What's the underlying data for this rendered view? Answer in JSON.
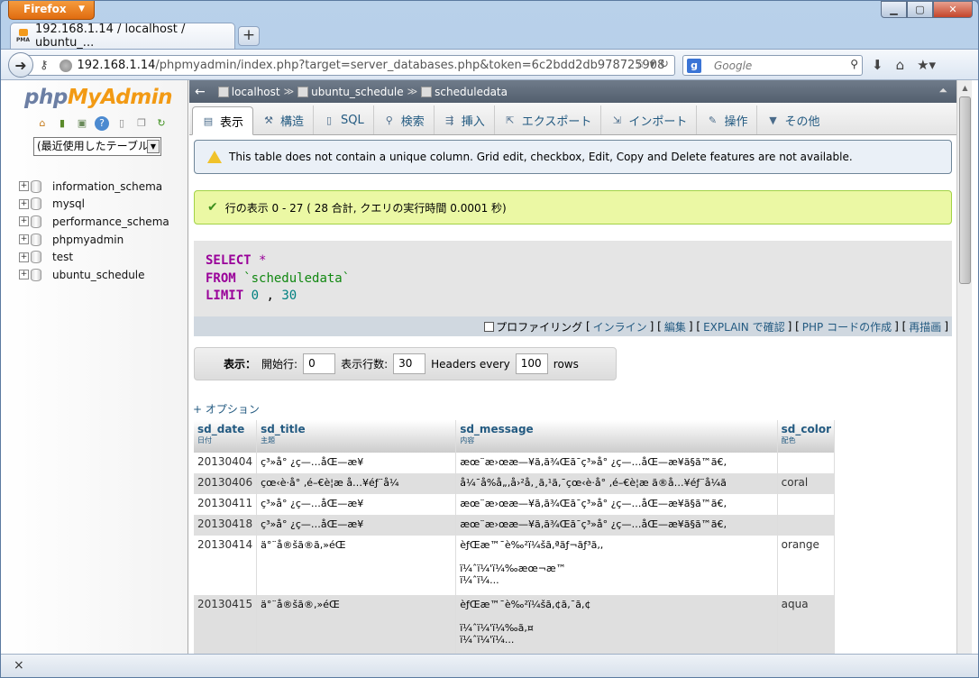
{
  "browser": {
    "app_button": "Firefox",
    "tab_title": "192.168.1.14 / localhost / ubuntu_...",
    "url_host": "192.168.1.14",
    "url_path": "/phpmyadmin/index.php?target=server_databases.php&token=6c2bdd2db978725908",
    "search_placeholder": "Google",
    "new_tab": "+",
    "close_addon": "×"
  },
  "sidebar": {
    "logo_php": "php",
    "logo_myadmin": "MyAdmin",
    "recent_select": "(最近使用したテーブル",
    "databases": [
      "information_schema",
      "mysql",
      "performance_schema",
      "phpmyadmin",
      "test",
      "ubuntu_schedule"
    ]
  },
  "breadcrumb": {
    "server": "localhost",
    "database": "ubuntu_schedule",
    "table": "scheduledata"
  },
  "tabs": [
    {
      "label": "表示",
      "icon": "▤"
    },
    {
      "label": "構造",
      "icon": "⚒"
    },
    {
      "label": "SQL",
      "icon": "▯"
    },
    {
      "label": "検索",
      "icon": "⚲"
    },
    {
      "label": "挿入",
      "icon": "⇶"
    },
    {
      "label": "エクスポート",
      "icon": "⇱"
    },
    {
      "label": "インポート",
      "icon": "⇲"
    },
    {
      "label": "操作",
      "icon": "✎"
    },
    {
      "label": "その他",
      "icon": "▼"
    }
  ],
  "notice": "This table does not contain a unique column. Grid edit, checkbox, Edit, Copy and Delete features are not available.",
  "success": "行の表示 0 - 27 ( 28 合計, クエリの実行時間 0.0001 秒)",
  "sql": {
    "select": "SELECT",
    "star": "*",
    "from": "FROM",
    "table": "`scheduledata`",
    "limit": "LIMIT",
    "offset": "0",
    "comma": ",",
    "count": "30"
  },
  "sql_links": {
    "profiling": "プロファイリング",
    "inline": "インライン",
    "edit": "編集",
    "explain": "EXPLAIN で確認",
    "php": "PHP コードの作成",
    "refresh": "再描画"
  },
  "navform": {
    "label": "表示：",
    "start_label": "開始行:",
    "start_value": "0",
    "rows_label": "表示行数:",
    "rows_value": "30",
    "headers_label": "Headers every",
    "headers_value": "100",
    "rows_suffix": "rows"
  },
  "options_link": "+ オプション",
  "table": {
    "columns": [
      {
        "name": "sd_date",
        "sub": "日付"
      },
      {
        "name": "sd_title",
        "sub": "主題"
      },
      {
        "name": "sd_message",
        "sub": "内容"
      },
      {
        "name": "sd_color",
        "sub": "配色"
      }
    ],
    "rows": [
      {
        "date": "20130404",
        "title": "ç³»å° ¿ç—…åŒ—æ¥",
        "message": [
          "æœ¨æ›œæ—¥ã‚ã¾Œã¯ç³»å° ¿ç—…åŒ—æ¥ã§ã™ã€‚"
        ],
        "color": ""
      },
      {
        "date": "20130406",
        "title": "çœ‹è­·å° ‚é–€è¦æ ­å…¥éƒ¨å¼",
        "message": [
          "å¼¯å%å„‚å›²å‚¸ã‚¹ã‚¯çœ‹è­·å° ‚é–€è¦æ ­ã®å…¥éƒ¨å¼ã"
        ],
        "color": "coral"
      },
      {
        "date": "20130411",
        "title": "ç³»å° ¿ç—…åŒ—æ¥",
        "message": [
          "æœ¨æ›œæ—¥ã‚ã¾Œã¯ç³»å° ¿ç—…åŒ—æ¥ã§ã™ã€‚"
        ],
        "color": ""
      },
      {
        "date": "20130418",
        "title": "ç³»å° ¿ç—…åŒ—æ¥",
        "message": [
          "æœ¨æ›œæ—¥ã‚ã¾Œã¯ç³»å° ¿ç—…åŒ—æ¥ã§ã™ã€‚"
        ],
        "color": ""
      },
      {
        "date": "20130414",
        "title": "ä°¨å®šã®ã,»éŒ",
        "message": [
          "èƒŒæ™¯è‰²ï¼šã,ªãƒ¬ãƒ³ã,,",
          "",
          "ï¼ˆï¼'ï¼‰æœ¬æ™",
          "ï¼ˆï¼..."
        ],
        "color": "orange"
      },
      {
        "date": "20130415",
        "title": "ä°¨å®šã®,»éŒ",
        "message": [
          "èƒŒæ™¯è‰²ï¼šã,¢ã,¯ã,¢",
          "",
          "ï¼ˆï¼'ï¼‰ã,¤",
          "ï¼ˆï¼'ï¼..."
        ],
        "color": "aqua"
      }
    ]
  }
}
